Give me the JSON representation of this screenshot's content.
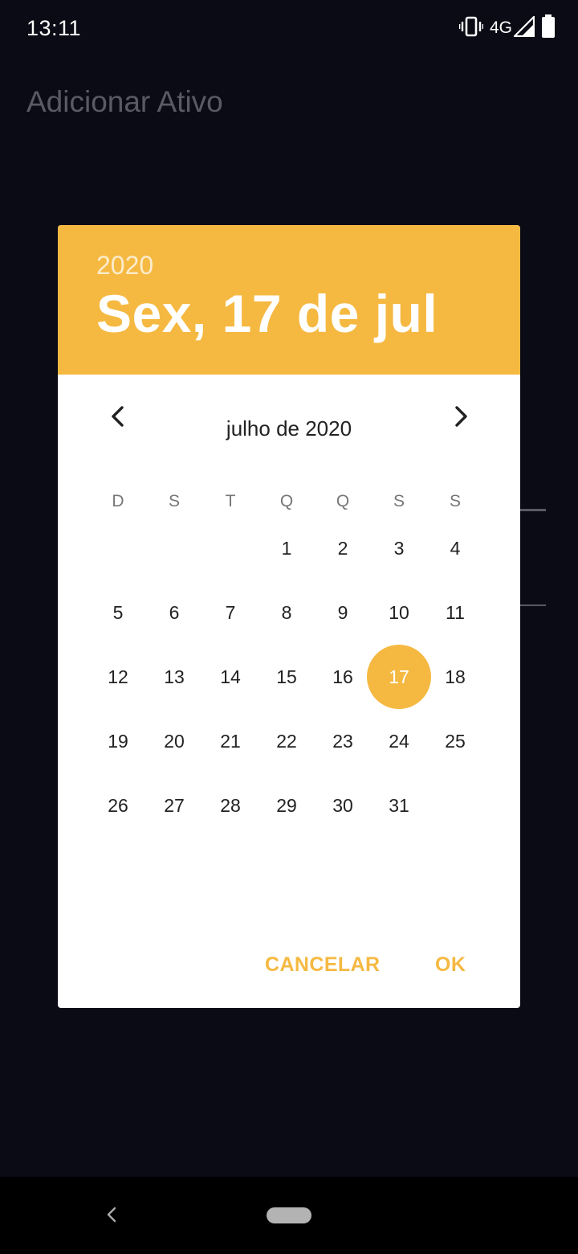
{
  "status_bar": {
    "time": "13:11",
    "network": "4G",
    "icons": [
      "vibrate-icon",
      "signal-icon",
      "battery-icon"
    ]
  },
  "app": {
    "title": "Adicionar Ativo"
  },
  "date_picker": {
    "year": "2020",
    "selected_date": "Sex, 17 de jul",
    "month_label": "julho de 2020",
    "weekdays": [
      "D",
      "S",
      "T",
      "Q",
      "Q",
      "S",
      "S"
    ],
    "first_weekday_index": 3,
    "days": [
      "1",
      "2",
      "3",
      "4",
      "5",
      "6",
      "7",
      "8",
      "9",
      "10",
      "11",
      "12",
      "13",
      "14",
      "15",
      "16",
      "17",
      "18",
      "19",
      "20",
      "21",
      "22",
      "23",
      "24",
      "25",
      "26",
      "27",
      "28",
      "29",
      "30",
      "31"
    ],
    "selected_day": "17",
    "cancel_label": "CANCELAR",
    "ok_label": "OK",
    "accent_color": "#f5b942"
  },
  "nav_bar": {
    "icons": [
      "back-icon",
      "home-pill"
    ]
  }
}
